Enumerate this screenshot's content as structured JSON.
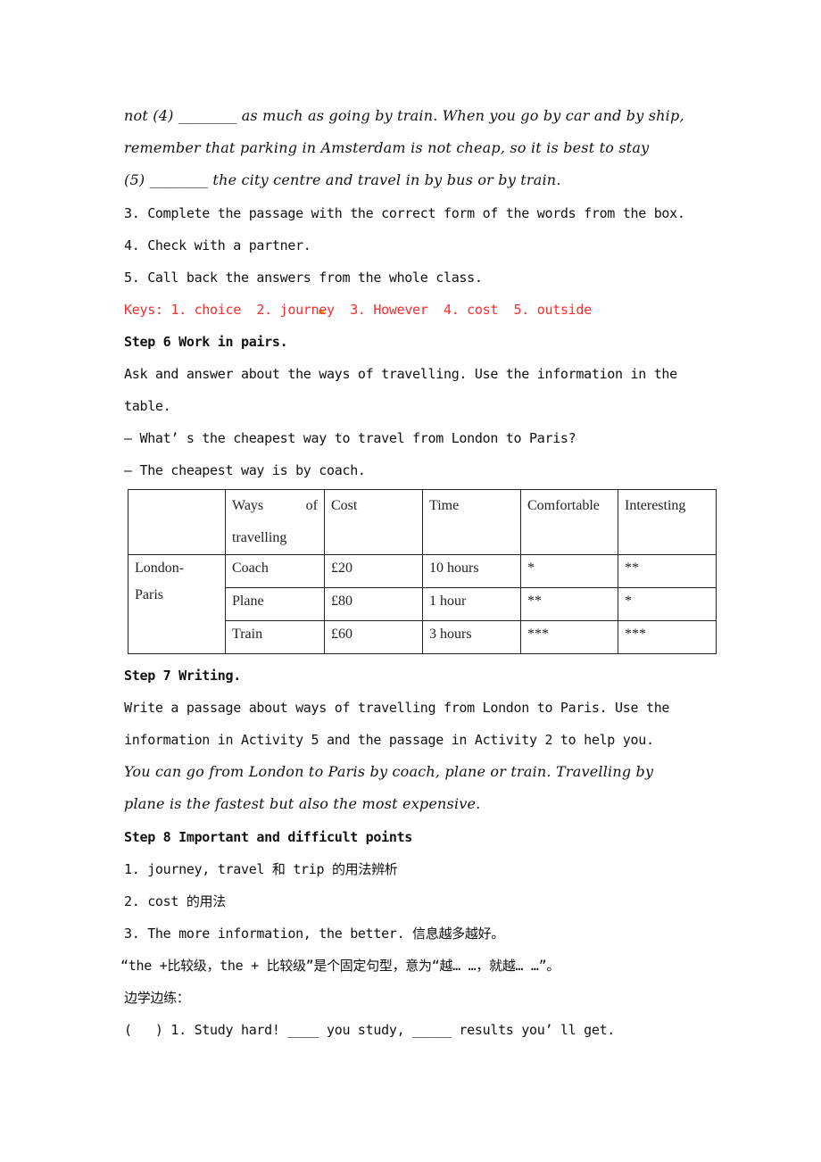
{
  "passage": {
    "line1": "not (4) ________ as much as going by train. When you go by car and by ship,",
    "line2": "remember that parking in Amsterdam is not cheap, so it is best to stay",
    "line3": "(5) ________ the city centre and travel in by bus or by train."
  },
  "procedure": [
    "3. Complete the passage with the correct form of the words from the box.",
    "4. Check with a partner.",
    "5. Call back the answers from the whole class."
  ],
  "keys": {
    "label": "Keys: 1. choice  2. journ",
    "label_tail": "ey  3. However  4. cost  5. outside",
    "color": "#ff2a2a"
  },
  "step6": {
    "heading": "Step 6 Work in pairs.",
    "instruction_line1": "Ask and answer about the ways of travelling. Use the information in the",
    "instruction_line2": "table.",
    "dialogue": [
      "— What’ s the cheapest way to travel from London to Paris?",
      "— The cheapest way is by coach."
    ]
  },
  "table": {
    "headers": [
      "",
      "Ways of travelling",
      "Cost",
      "Time",
      "Comfortable",
      "Interesting"
    ],
    "header_ways_word1": "Ways",
    "header_ways_word2": "of",
    "header_ways_word3": "travelling",
    "route_line1": "London-",
    "route_line2": "Paris",
    "rows": [
      {
        "way": "Coach",
        "cost": "£20",
        "time": "10 hours",
        "comfortable": "*",
        "interesting": "**"
      },
      {
        "way": "Plane",
        "cost": "£80",
        "time": "1 hour",
        "comfortable": "**",
        "interesting": "*"
      },
      {
        "way": "Train",
        "cost": "£60",
        "time": "3 hours",
        "comfortable": "***",
        "interesting": "***"
      }
    ]
  },
  "step7": {
    "heading": "Step 7 Writing.",
    "instruction_line1": "Write a passage about ways of travelling from London to Paris. Use the",
    "instruction_line2": "information in Activity 5 and the passage in Activity 2 to help you.",
    "example_line1": "You can go from London to Paris by coach, plane or train. Travelling by",
    "example_line2": "plane is the fastest but also the most expensive."
  },
  "step8": {
    "heading": "Step 8 Important and difficult points",
    "points": [
      "1. journey, travel 和 trip 的用法辨析",
      "2. cost 的用法",
      "3. The more information, the better. 信息越多越好。"
    ],
    "note": "“the +比较级，the + 比较级”是个固定句型，意为“越… …，就越… …”。",
    "practice_label": "边学边练：",
    "exercise": "(   ) 1. Study hard! ____ you study, _____ results you’ ll get."
  }
}
